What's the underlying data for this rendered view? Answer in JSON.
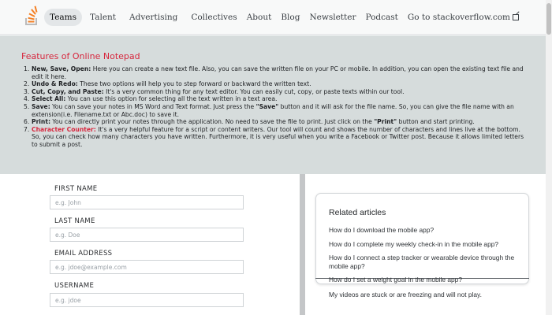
{
  "nav": {
    "left": [
      "Teams",
      "Talent",
      "Advertising",
      "Collectives"
    ],
    "right": [
      "About",
      "Blog",
      "Newsletter",
      "Podcast",
      "Go to stackoverflow.com"
    ],
    "logo_icon": "stackoverflow-logo-icon",
    "external_icon": "external-link-icon"
  },
  "features": {
    "title": "Features of Online Notepad",
    "items": [
      {
        "num": "1.",
        "head": "New, Save, Open:",
        "text": " Here you can create a new text file. Also, you can save the written file on your PC or mobile. In addition, you can open the existing text file and edit it here."
      },
      {
        "num": "2.",
        "head": "Undo & Redo:",
        "text": " These two options will help you to step forward or backward the written text."
      },
      {
        "num": "3.",
        "head": "Cut, Copy, and Paste:",
        "text": " It's a very common thing for any text editor. You can easily cut, copy, or paste texts within our tool."
      },
      {
        "num": "4.",
        "head": "Select All:",
        "text": " You can use this option for selecting all the text written in a text area."
      },
      {
        "num": "5.",
        "head": "Save:",
        "text": " You can save your notes in MS Word and Text format. Just press the ",
        "b1": "\"Save\"",
        "text2": " button and it will ask for the file name. So, you can give the file name with an extension(i.e. Filename.txt or Abc.doc) to save it."
      },
      {
        "num": "6.",
        "head": "Print:",
        "text": " You can directly print your notes through the application. No need to save the file to print. Just click on the ",
        "b1": "\"Print\"",
        "text2": " button and start printing."
      },
      {
        "num": "7.",
        "head": "Character Counter:",
        "text": " It's a very helpful feature for a script or content writers. Our tool will count and shows the number of characters and lines live at the bottom. So, you can check how many characters you have written. Furthermore, it is very useful when you write a Facebook or Twitter post. Because it allows limited letters to submit a post."
      }
    ]
  },
  "form": {
    "first_name": {
      "label": "FIRST NAME",
      "placeholder": "e.g. John"
    },
    "last_name": {
      "label": "LAST NAME",
      "placeholder": "e.g. Doe"
    },
    "email": {
      "label": "EMAIL ADDRESS",
      "placeholder": "e.g. jdoe@example.com"
    },
    "username": {
      "label": "USERNAME",
      "placeholder": "e.g. jdoe"
    }
  },
  "related": {
    "title": "Related articles",
    "links": [
      "How do I download the mobile app?",
      "How do I complete my weekly check-in in the mobile app?",
      "How do I connect a step tracker or wearable device through the mobile app?",
      "How do I set a weight goal in the mobile app?",
      "My videos are stuck or are freezing and will not play."
    ]
  },
  "colors": {
    "accent_red": "#d7263d",
    "logo_orange": "#f48024",
    "logo_gray": "#bcbbbb"
  }
}
